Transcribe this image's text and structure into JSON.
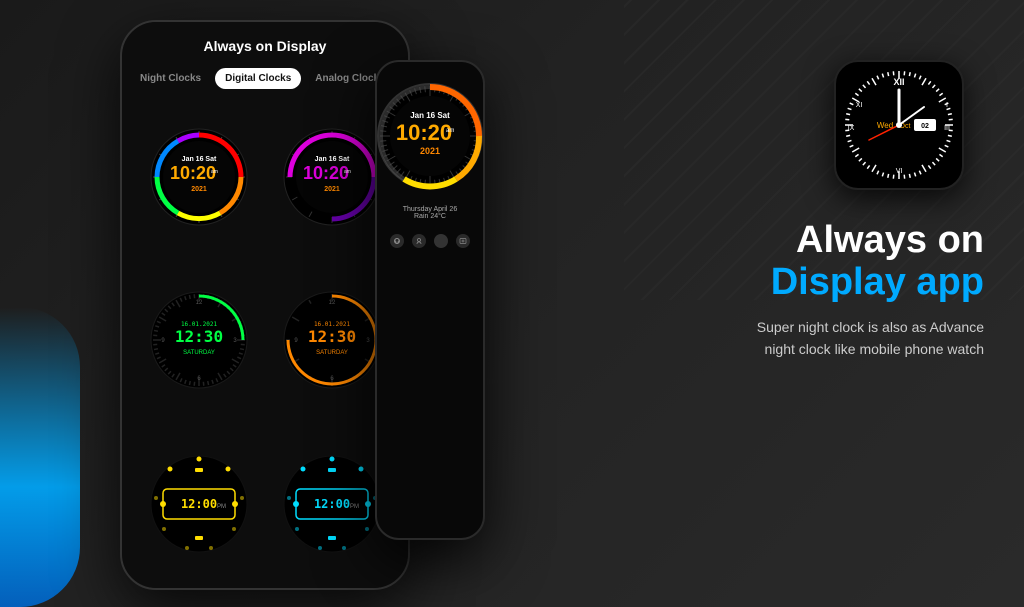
{
  "background": {
    "color": "#1a1a1a"
  },
  "phone_main": {
    "title": "Always on Display",
    "tabs": [
      {
        "label": "Night Clocks",
        "active": false
      },
      {
        "label": "Digital Clocks",
        "active": true
      },
      {
        "label": "Analog Clocks",
        "active": false
      }
    ],
    "clocks": [
      {
        "id": "rainbow",
        "type": "rainbow",
        "date": "Jan 16 Sat",
        "time": "10:20",
        "ampm": "am",
        "year": "2021",
        "color": "#ff8800"
      },
      {
        "id": "purple",
        "type": "purple",
        "date": "Jan 16 Sat",
        "time": "10:20",
        "ampm": "am",
        "year": "2021",
        "color": "#dd00dd"
      },
      {
        "id": "green-digital",
        "type": "digital",
        "date": "16.01.2021",
        "time": "12:30",
        "day": "SATURDAY",
        "color": "#00ff44"
      },
      {
        "id": "orange-digital",
        "type": "digital",
        "date": "16.01.2021",
        "time": "12:30",
        "day": "SATURDAY",
        "color": "#ff8800"
      },
      {
        "id": "yellow-rect",
        "type": "rect",
        "time": "12:00",
        "ampm": "PM",
        "color": "#ffdd00"
      },
      {
        "id": "cyan-rect",
        "type": "rect",
        "time": "12:00",
        "ampm": "PM",
        "color": "#00ddff"
      }
    ]
  },
  "phone_featured": {
    "clock": {
      "date": "Jan 16 Sat",
      "time": "10:20",
      "ampm": "am",
      "year": "2021"
    },
    "weather": {
      "line1": "Thursday April 26",
      "line2": "Rain 24°C"
    }
  },
  "analog_watch": {
    "day": "Wed",
    "date": "02",
    "month": "Oct"
  },
  "hero": {
    "line1": "Always on",
    "line2": "Display app",
    "subtitle_line1": "Super night clock is also as Advance",
    "subtitle_line2": "night clock like mobile phone watch"
  }
}
